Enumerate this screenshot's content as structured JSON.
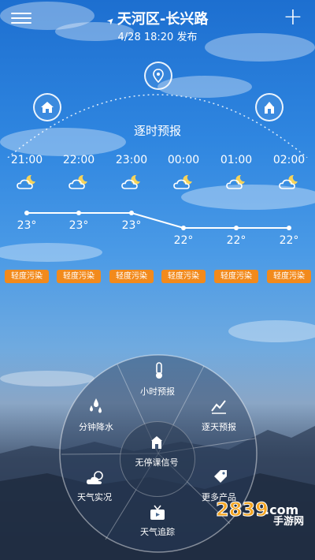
{
  "header": {
    "location": "天河区-长兴路",
    "published": "4/28 18:20 发布"
  },
  "forecast": {
    "title": "逐时预报",
    "hours": [
      {
        "time": "21:00",
        "temp": "23°",
        "aqi": "轻度污染",
        "icon": "cloudy-night-icon"
      },
      {
        "time": "22:00",
        "temp": "23°",
        "aqi": "轻度污染",
        "icon": "cloudy-night-icon"
      },
      {
        "time": "23:00",
        "temp": "23°",
        "aqi": "轻度污染",
        "icon": "cloudy-night-icon"
      },
      {
        "time": "00:00",
        "temp": "22°",
        "aqi": "轻度污染",
        "icon": "cloudy-night-icon"
      },
      {
        "time": "01:00",
        "temp": "22°",
        "aqi": "轻度污染",
        "icon": "cloudy-night-icon"
      },
      {
        "time": "02:00",
        "temp": "22°",
        "aqi": "轻度污染",
        "icon": "cloudy-night-icon"
      }
    ]
  },
  "orbit_icons": [
    "home-icon",
    "location-pin-icon",
    "building-icon"
  ],
  "wheel": {
    "items": [
      {
        "label": "小时预报",
        "icon": "thermometer-icon"
      },
      {
        "label": "逐天预报",
        "icon": "trend-icon"
      },
      {
        "label": "更多产品",
        "icon": "tag-icon"
      },
      {
        "label": "天气追踪",
        "icon": "tv-icon"
      },
      {
        "label": "天气实况",
        "icon": "partly-cloudy-icon"
      },
      {
        "label": "分钟降水",
        "icon": "raindrops-icon"
      }
    ],
    "center": {
      "label": "无停课信号",
      "icon": "school-icon"
    }
  },
  "watermark": {
    "number": "2839.com",
    "text": "手游网"
  },
  "colors": {
    "aqi_badge": "#f28a1c"
  }
}
